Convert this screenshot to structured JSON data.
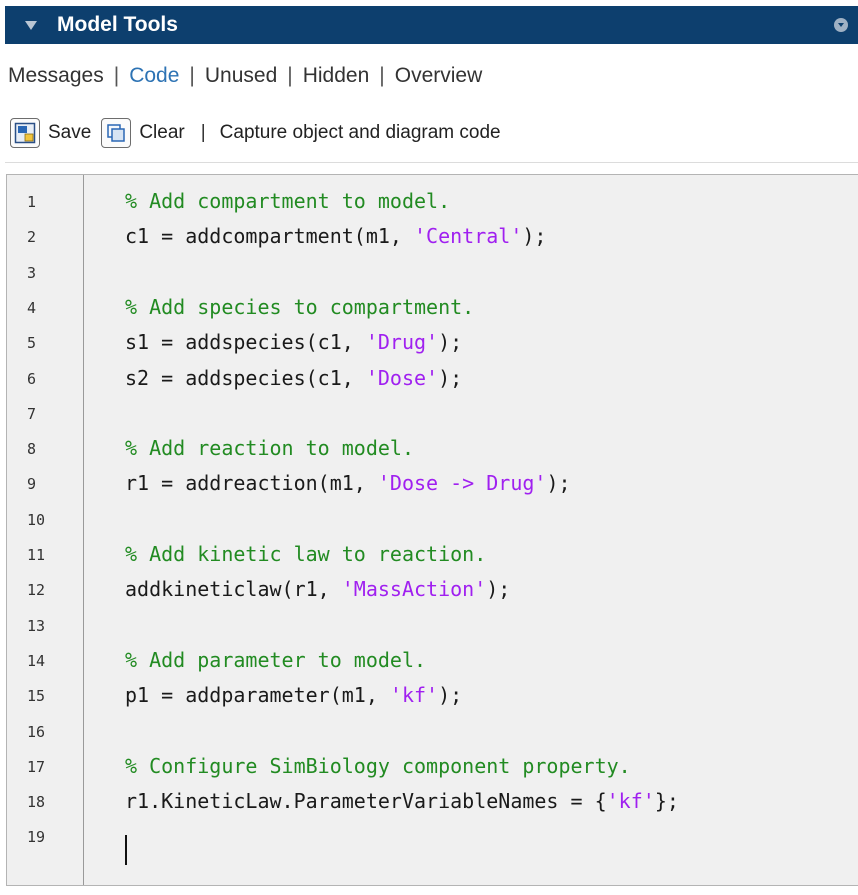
{
  "panel": {
    "title": "Model Tools"
  },
  "tabs": [
    {
      "label": "Messages",
      "active": false
    },
    {
      "label": "Code",
      "active": true
    },
    {
      "label": "Unused",
      "active": false
    },
    {
      "label": "Hidden",
      "active": false
    },
    {
      "label": "Overview",
      "active": false
    }
  ],
  "tab_separator": "|",
  "toolbar": {
    "save_label": "Save",
    "clear_label": "Clear",
    "separator": "|",
    "capture_label": "Capture object and diagram code"
  },
  "colors": {
    "titlebar": "#0d3f6e",
    "active_tab": "#2d73b4",
    "comment": "#228b22",
    "string": "#a020f0",
    "editor_bg": "#f0f0f0"
  },
  "icons": {
    "collapse": "triangle-down-icon",
    "panel_menu": "circle-menu-icon",
    "save": "save-icon",
    "clear": "clear-icon"
  },
  "editor": {
    "lines": [
      {
        "num": "1",
        "comment": "% Add compartment to model.",
        "pre": "",
        "str": "",
        "post": ""
      },
      {
        "num": "2",
        "comment": "",
        "pre": "c1 = addcompartment(m1, ",
        "str": "'Central'",
        "post": ");"
      },
      {
        "num": "3",
        "comment": "",
        "pre": "",
        "str": "",
        "post": ""
      },
      {
        "num": "4",
        "comment": "% Add species to compartment.",
        "pre": "",
        "str": "",
        "post": ""
      },
      {
        "num": "5",
        "comment": "",
        "pre": "s1 = addspecies(c1, ",
        "str": "'Drug'",
        "post": ");"
      },
      {
        "num": "6",
        "comment": "",
        "pre": "s2 = addspecies(c1, ",
        "str": "'Dose'",
        "post": ");"
      },
      {
        "num": "7",
        "comment": "",
        "pre": "",
        "str": "",
        "post": ""
      },
      {
        "num": "8",
        "comment": "% Add reaction to model.",
        "pre": "",
        "str": "",
        "post": ""
      },
      {
        "num": "9",
        "comment": "",
        "pre": "r1 = addreaction(m1, ",
        "str": "'Dose -> Drug'",
        "post": ");"
      },
      {
        "num": "10",
        "comment": "",
        "pre": "",
        "str": "",
        "post": ""
      },
      {
        "num": "11",
        "comment": "% Add kinetic law to reaction.",
        "pre": "",
        "str": "",
        "post": ""
      },
      {
        "num": "12",
        "comment": "",
        "pre": "addkineticlaw(r1, ",
        "str": "'MassAction'",
        "post": ");"
      },
      {
        "num": "13",
        "comment": "",
        "pre": "",
        "str": "",
        "post": ""
      },
      {
        "num": "14",
        "comment": "% Add parameter to model.",
        "pre": "",
        "str": "",
        "post": ""
      },
      {
        "num": "15",
        "comment": "",
        "pre": "p1 = addparameter(m1, ",
        "str": "'kf'",
        "post": ");"
      },
      {
        "num": "16",
        "comment": "",
        "pre": "",
        "str": "",
        "post": ""
      },
      {
        "num": "17",
        "comment": "% Configure SimBiology component property.",
        "pre": "",
        "str": "",
        "post": ""
      },
      {
        "num": "18",
        "comment": "",
        "pre": "r1.KineticLaw.ParameterVariableNames = {",
        "str": "'kf'",
        "post": "};"
      },
      {
        "num": "19",
        "comment": "",
        "pre": "",
        "str": "",
        "post": ""
      }
    ]
  }
}
